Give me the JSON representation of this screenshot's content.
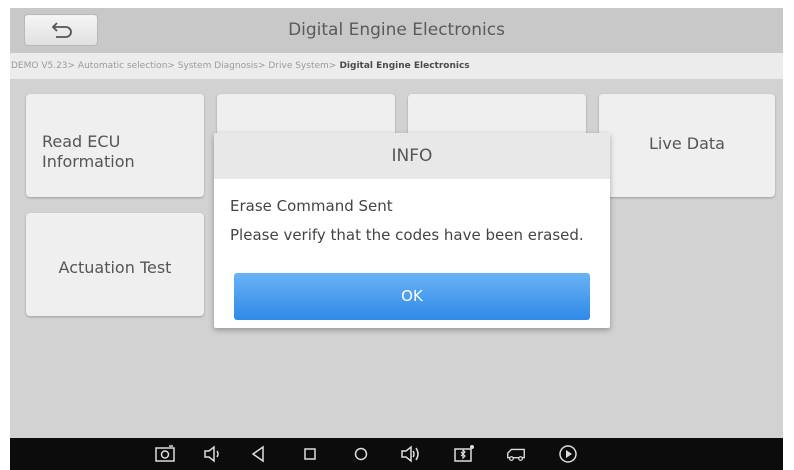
{
  "header": {
    "title": "Digital Engine Electronics"
  },
  "breadcrumb": {
    "path": "DEMO V5.23> Automatic selection> System Diagnosis> Drive System>",
    "current": " Digital Engine Electronics"
  },
  "tiles": {
    "read_ecu": "Read ECU Information",
    "live_data": "Live Data",
    "actuation_test": "Actuation Test"
  },
  "dialog": {
    "title": "INFO",
    "message_line1": "Erase Command Sent",
    "message_line2": "Please verify that the codes have been erased.",
    "ok_label": "OK"
  },
  "colors": {
    "accent": "#3d94ec",
    "header_bg": "#c8c8c8",
    "navbar_bg": "#0c0c0c"
  },
  "navbar": {
    "icons": [
      "screenshot-icon",
      "volume-down-icon",
      "back-icon",
      "recent-apps-icon",
      "home-icon",
      "volume-up-icon",
      "vci-bluetooth-icon",
      "vehicle-icon",
      "play-icon"
    ]
  }
}
